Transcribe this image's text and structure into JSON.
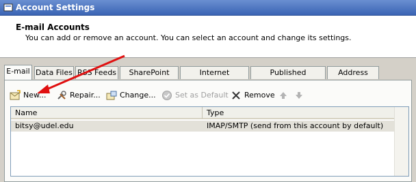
{
  "window": {
    "title": "Account Settings"
  },
  "header": {
    "title": "E-mail Accounts",
    "subtitle": "You can add or remove an account. You can select an account and change its settings."
  },
  "tabs": [
    {
      "label": "E-mail"
    },
    {
      "label": "Data Files"
    },
    {
      "label": "RSS Feeds"
    },
    {
      "label": "SharePoint Lists"
    },
    {
      "label": "Internet Calendars"
    },
    {
      "label": "Published Calendars"
    },
    {
      "label": "Address Books"
    }
  ],
  "toolbar": {
    "new_label": "New...",
    "repair_label": "Repair...",
    "change_label": "Change...",
    "default_label": "Set as Default",
    "remove_label": "Remove"
  },
  "list": {
    "headers": {
      "name": "Name",
      "type": "Type"
    },
    "rows": [
      {
        "name": "bitsy@udel.edu",
        "type": "IMAP/SMTP (send from this account by default)"
      }
    ]
  },
  "colors": {
    "annotation_arrow": "#e01010",
    "title_bar": "#3a64b4"
  }
}
